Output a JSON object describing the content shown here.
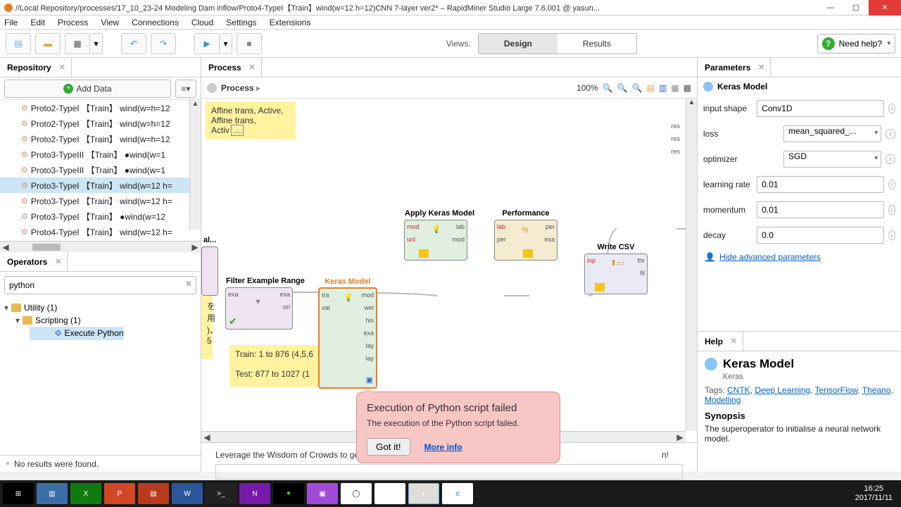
{
  "titlebar": {
    "title": "//Local Repository/processes/17_10_23-24 Modeling Dam inflow/Proto4-TypeI【Train】wind(w=12 h=12)CNN 7-layer ver2* – RapidMiner Studio Large 7.6.001 @ yasun..."
  },
  "menu": [
    "File",
    "Edit",
    "Process",
    "View",
    "Connections",
    "Cloud",
    "Settings",
    "Extensions"
  ],
  "views": {
    "label": "Views:",
    "design": "Design",
    "results": "Results"
  },
  "help_button": "Need help?",
  "panels": {
    "repository": "Repository",
    "operators": "Operators",
    "process": "Process",
    "parameters": "Parameters",
    "help": "Help"
  },
  "add_data": "Add Data",
  "repo_items": [
    {
      "label": "Proto2-TypeI 【Train】 wind(w=h=12",
      "sel": false
    },
    {
      "label": "Proto2-TypeI 【Train】 wind(w=h=12",
      "sel": false
    },
    {
      "label": "Proto2-TypeI 【Train】 wind(w=h=12",
      "sel": false
    },
    {
      "label": "Proto3-TypeIII 【Train】 ●wind(w=1",
      "sel": false
    },
    {
      "label": "Proto3-TypeIII 【Train】 ●wind(w=1",
      "sel": false
    },
    {
      "label": "Proto3-TypeI 【Train】 wind(w=12 h=",
      "sel": true
    },
    {
      "label": "Proto3-TypeI 【Train】 wind(w=12 h=",
      "sel": false
    },
    {
      "label": "Proto3-TypeI 【Train】 ●wind(w=12",
      "sel": false
    },
    {
      "label": "Proto4-TypeI 【Train】 wind(w=12 h=",
      "sel": false
    }
  ],
  "ops_search": "python",
  "ops_tree": {
    "utility": "Utility (1)",
    "scripting": "Scripting (1)",
    "leaf": "Execute Python"
  },
  "status_no_results": "No results were found.",
  "process": {
    "crumbs": "Process",
    "zoom": "100%",
    "note1_l1": "Affine trans, Active,",
    "note1_l2": "Affine trans, Activ",
    "note_train": "Train: 1 to 876 (4,5,6",
    "note_test": "Test: 877 to 1027 (1",
    "note2": "を用\n)、\n5",
    "op_filter": "Filter Example Range",
    "op_keras": "Keras Model",
    "op_apply": "Apply Keras Model",
    "op_perf": "Performance",
    "op_csv": "Write CSV",
    "op_al": "al...",
    "ports_filter": {
      "exa": "exa",
      "exa2": "exa",
      "ori": "ori"
    },
    "ports_keras": {
      "tra": "tra",
      "val": "val",
      "mod": "mod",
      "wei": "wei",
      "his": "his",
      "exa": "exa",
      "lay": "lay",
      "lay2": "lay"
    },
    "ports_apply": {
      "mod": "mod",
      "unl": "unl",
      "lab": "lab",
      "mod2": "mod"
    },
    "ports_perf": {
      "lab": "lab",
      "per": "per",
      "per2": "per",
      "exa": "exa"
    },
    "ports_csv": {
      "inp": "inp",
      "thr": "thr",
      "fil": "fil"
    },
    "res": "res"
  },
  "hints": "Leverage the Wisdom of Crowds to get operator recommendations based on your process design!",
  "hints_short": "Leverage the Wisdom of Crowds to get ",
  "params": {
    "title": "Keras Model",
    "rows": [
      {
        "label": "input shape",
        "value": "Conv1D",
        "type": "text"
      },
      {
        "label": "loss",
        "value": "mean_squared_...",
        "type": "select"
      },
      {
        "label": "optimizer",
        "value": "SGD",
        "type": "select"
      },
      {
        "label": "learning rate",
        "value": "0.01",
        "type": "text"
      },
      {
        "label": "momentum",
        "value": "0.01",
        "type": "text"
      },
      {
        "label": "decay",
        "value": "0.0",
        "type": "text"
      }
    ],
    "hide": "Hide advanced parameters"
  },
  "help": {
    "title": "Keras Model",
    "sub": "Keras",
    "tags_label": "Tags: ",
    "tags": [
      "CNTK",
      "Deep Learning",
      "TensorFlow",
      "Theano",
      "Modelling"
    ],
    "syn_h": "Synopsis",
    "syn_p": "The superoperator to initialise a neural network model."
  },
  "callout": {
    "title": "Execution of Python script failed",
    "body": "The execution of the Python script failed.",
    "ok": "Got it!",
    "more": "More info"
  },
  "clock": {
    "time": "16:25",
    "date": "2017/11/11"
  }
}
